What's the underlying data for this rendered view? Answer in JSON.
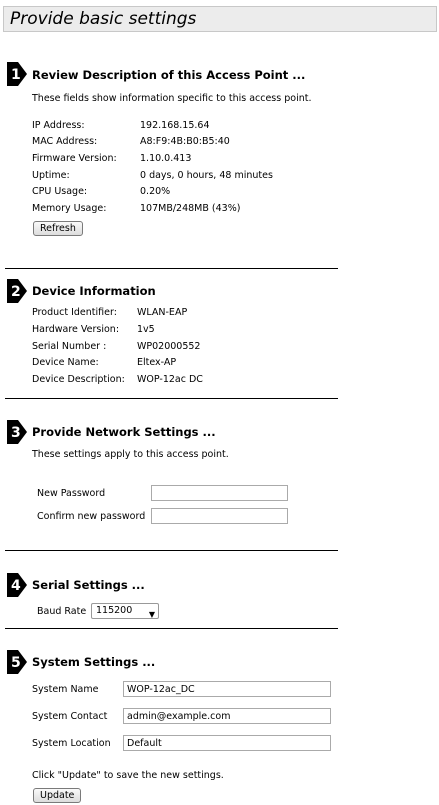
{
  "page_title": "Provide basic settings",
  "sections": {
    "review": {
      "number": "1",
      "title": "Review Description of this Access Point ...",
      "description": "These fields show information specific to this access point.",
      "rows": [
        {
          "label": "IP Address:",
          "value": "192.168.15.64"
        },
        {
          "label": "MAC Address:",
          "value": "A8:F9:4B:B0:B5:40"
        },
        {
          "label": "Firmware Version:",
          "value": "1.10.0.413"
        },
        {
          "label": "Uptime:",
          "value": "0 days, 0 hours, 48 minutes"
        },
        {
          "label": "CPU Usage:",
          "value": "0.20%"
        },
        {
          "label": "Memory Usage:",
          "value": "107MB/248MB (43%)"
        }
      ],
      "refresh_label": "Refresh"
    },
    "device": {
      "number": "2",
      "title": "Device Information",
      "rows": [
        {
          "label": "Product Identifier:",
          "value": "WLAN-EAP"
        },
        {
          "label": "Hardware Version:",
          "value": "1v5"
        },
        {
          "label": "Serial Number :",
          "value": "WP02000552"
        },
        {
          "label": "Device Name:",
          "value": "Eltex-AP"
        },
        {
          "label": "Device Description:",
          "value": "WOP-12ac DC"
        }
      ]
    },
    "network": {
      "number": "3",
      "title": "Provide Network Settings ...",
      "description": "These settings apply to this access point.",
      "new_password_label": "New Password",
      "new_password_value": "",
      "confirm_password_label": "Confirm new password",
      "confirm_password_value": ""
    },
    "serial": {
      "number": "4",
      "title": "Serial Settings ...",
      "baud_rate_label": "Baud Rate",
      "baud_rate_value": "115200"
    },
    "system": {
      "number": "5",
      "title": "System Settings ...",
      "system_name_label": "System Name",
      "system_name_value": "WOP-12ac_DC",
      "system_contact_label": "System Contact",
      "system_contact_value": "admin@example.com",
      "system_location_label": "System Location",
      "system_location_value": "Default",
      "update_hint": "Click \"Update\" to save the new settings.",
      "update_label": "Update"
    }
  }
}
